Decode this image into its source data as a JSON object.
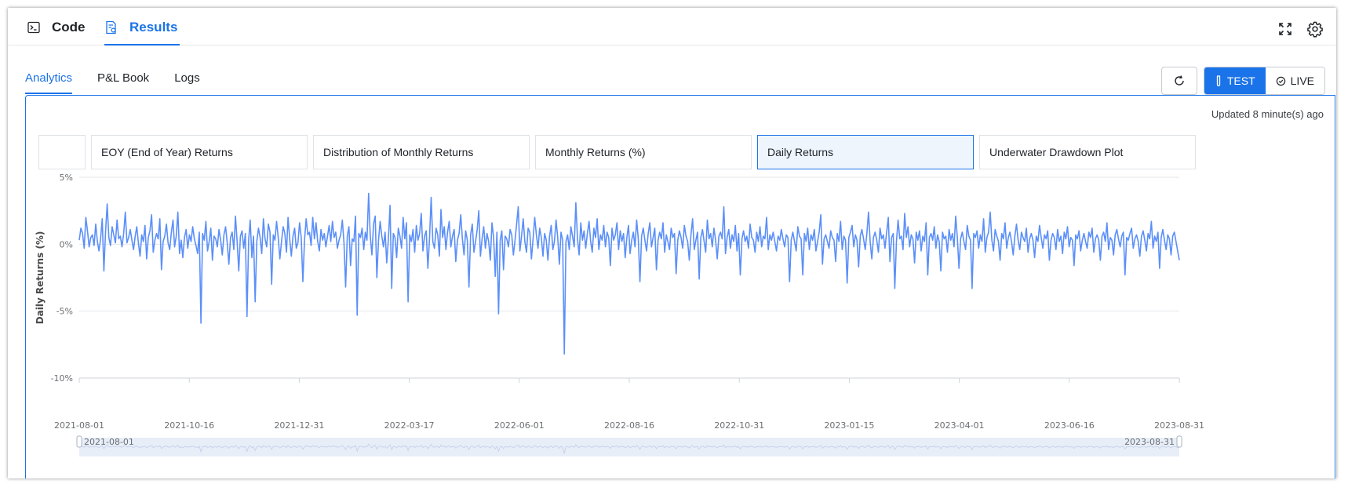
{
  "top_tabs": [
    {
      "label": "Code",
      "icon": "terminal-icon"
    },
    {
      "label": "Results",
      "icon": "report-icon",
      "active": true
    }
  ],
  "sub_tabs": [
    {
      "label": "Analytics",
      "active": true
    },
    {
      "label": "P&L Book"
    },
    {
      "label": "Logs"
    }
  ],
  "mode": {
    "test_label": "TEST",
    "live_label": "LIVE",
    "selected": "TEST"
  },
  "updated_text": "Updated 8 minute(s) ago",
  "chart_tabs": [
    {
      "label": ""
    },
    {
      "label": "EOY (End of Year) Returns"
    },
    {
      "label": "Distribution of Monthly Returns"
    },
    {
      "label": "Monthly Returns (%)"
    },
    {
      "label": "Daily Returns",
      "active": true
    },
    {
      "label": "Underwater Drawdown Plot"
    }
  ],
  "colors": {
    "accent": "#1a73e8",
    "series": "#5b8ff9",
    "active_tab_bg": "#eef5fc"
  },
  "chart_data": {
    "type": "line",
    "title": "",
    "ylabel": "Daily Returns (%)",
    "xlabel": "",
    "ylim": [
      -10,
      5
    ],
    "y_ticks": [
      "5%",
      "0%",
      "-5%",
      "-10%"
    ],
    "y_tick_values": [
      5,
      0,
      -5,
      -10
    ],
    "x_range": [
      "2021-08-01",
      "2023-08-31"
    ],
    "x_ticks": [
      "2021-08-01",
      "2021-10-16",
      "2021-12-31",
      "2022-03-17",
      "2022-06-01",
      "2022-08-16",
      "2022-10-31",
      "2023-01-15",
      "2023-04-01",
      "2023-06-16",
      "2023-08-31"
    ],
    "grid": true,
    "series": [
      {
        "values": [
          0.3,
          1.2,
          0.8,
          -0.3,
          2.0,
          1.0,
          -0.2,
          0.5,
          0.7,
          -0.1,
          1.5,
          0.2,
          -0.5,
          0.4,
          1.9,
          -2.0,
          0.9,
          3.0,
          0.5,
          -0.1,
          1.3,
          0.7,
          0.1,
          1.8,
          0.4,
          0.6,
          -0.2,
          0.8,
          2.4,
          0.1,
          0.5,
          1.1,
          0.3,
          -0.4,
          0.6,
          1.3,
          0.1,
          -0.9,
          0.7,
          0.2,
          1.4,
          -1.1,
          0.5,
          1.0,
          2.2,
          -0.6,
          0.3,
          0.8,
          0.4,
          1.9,
          -1.9,
          0.2,
          0.6,
          1.5,
          0.1,
          -0.4,
          0.9,
          1.8,
          -0.2,
          0.6,
          2.4,
          -0.7,
          0.3,
          -1.0,
          0.5,
          1.1,
          -0.3,
          0.7,
          0.2,
          1.3,
          0.4,
          -0.1,
          -0.7,
          0.9,
          -5.9,
          0.8,
          0.3,
          1.7,
          -0.5,
          0.2,
          1.2,
          -1.2,
          0.6,
          0.4,
          -0.2,
          1.1,
          0.3,
          -0.8,
          0.7,
          1.3,
          0.1,
          -1.5,
          0.5,
          0.9,
          -0.4,
          2.1,
          0.2,
          -2.0,
          0.6,
          1.0,
          -0.3,
          0.8,
          -5.4,
          0.3,
          1.8,
          -1.0,
          0.6,
          -4.3,
          0.2,
          1.2,
          0.5,
          -0.7,
          1.9,
          0.4,
          -0.2,
          1.5,
          0.9,
          -3.0,
          0.7,
          0.3,
          1.7,
          0.5,
          -1.1,
          0.2,
          1.3,
          0.8,
          -0.6,
          2.0,
          0.4,
          -0.9,
          0.6,
          1.2,
          -0.3,
          0.1,
          1.6,
          0.5,
          -2.8,
          0.3,
          1.9,
          0.7,
          0.9,
          -0.1,
          2.0,
          0.4,
          1.6,
          0.2,
          -0.5,
          1.1,
          0.3,
          0.8,
          -0.2,
          0.6,
          1.4,
          0.2,
          1.7,
          0.5,
          0.9,
          -0.3,
          0.3,
          0.7,
          1.8,
          0.1,
          -3.2,
          0.6,
          1.3,
          -1.6,
          0.4,
          0.2,
          2.1,
          -5.3,
          0.8,
          0.5,
          1.2,
          -0.4,
          0.9,
          0.3,
          3.8,
          0.6,
          -0.8,
          1.5,
          2.1,
          -2.5,
          0.3,
          1.7,
          0.6,
          -0.2,
          0.9,
          -1.4,
          0.4,
          2.9,
          -3.3,
          0.8,
          0.5,
          -1.0,
          1.2,
          0.6,
          -0.3,
          2.0,
          0.4,
          1.6,
          -4.3,
          0.7,
          0.2,
          1.1,
          -0.6,
          1.4,
          0.3,
          0.8,
          2.3,
          -0.5,
          0.6,
          1.0,
          -1.8,
          0.4,
          3.5,
          0.2,
          -0.3,
          1.2,
          0.7,
          -0.9,
          2.6,
          0.5,
          1.3,
          -0.4,
          0.9,
          1.7,
          -0.2,
          0.6,
          1.1,
          -1.3,
          0.3,
          0.8,
          2.2,
          0.4,
          -0.8,
          1.0,
          0.3,
          -3.2,
          0.7,
          1.5,
          -0.6,
          0.2,
          1.1,
          2.5,
          -0.9,
          0.4,
          1.3,
          -0.3,
          0.8,
          0.2,
          -1.2,
          1.6,
          0.5,
          -2.4,
          0.9,
          -5.2,
          0.3,
          1.0,
          -1.9,
          0.6,
          0.4,
          -0.2,
          1.1,
          0.7,
          -0.8,
          0.3,
          1.5,
          2.8,
          -0.5,
          0.6,
          1.9,
          0.2,
          -0.6,
          1.2,
          0.9,
          -1.1,
          0.4,
          2.0,
          0.7,
          -0.3,
          1.2,
          0.5,
          -0.9,
          0.8,
          0.3,
          -1.2,
          0.6,
          1.4,
          -0.4,
          0.2,
          1.8,
          0.5,
          -1.5,
          0.9,
          0.3,
          -8.2,
          0.2,
          0.7,
          -0.4,
          1.3,
          0.6,
          -0.2,
          3.1,
          0.4,
          -0.8,
          1.6,
          0.3,
          1.0,
          -0.3,
          0.8,
          1.7,
          0.2,
          -0.6,
          1.2,
          0.5,
          1.9,
          -0.4,
          0.7,
          0.3,
          1.4,
          -0.2,
          0.9,
          0.5,
          -1.6,
          1.2,
          0.3,
          0.7,
          1.6,
          -0.4,
          1.0,
          0.2,
          0.8,
          -1.0,
          0.5,
          1.4,
          -0.7,
          0.3,
          0.9,
          -0.2,
          1.8,
          0.4,
          -2.8,
          0.6,
          1.2,
          0.3,
          -0.5,
          0.8,
          1.6,
          -0.2,
          0.5,
          1.2,
          -1.9,
          0.3,
          0.9,
          0.4,
          1.6,
          -0.6,
          0.7,
          0.2,
          -0.4,
          1.2,
          0.5,
          0.8,
          -2.2,
          0.3,
          1.0,
          0.5,
          -0.3,
          1.4,
          0.6,
          0.2,
          -1.2,
          0.7,
          1.9,
          -0.4,
          0.3,
          0.9,
          -2.6,
          0.5,
          1.1,
          0.2,
          -0.6,
          1.8,
          0.4,
          0.8,
          -0.2,
          1.2,
          0.3,
          -1.1,
          0.6,
          0.9,
          0.4,
          2.8,
          -0.7,
          0.5,
          1.1,
          -0.3,
          0.7,
          0.2,
          1.4,
          -0.5,
          0.8,
          -2.3,
          0.4,
          1.0,
          0.2,
          0.6,
          -0.3,
          1.5,
          0.5,
          0.3,
          -0.6,
          0.9,
          0.2,
          1.3,
          -0.2,
          0.6,
          0.4,
          2.0,
          -0.4,
          0.7,
          0.3,
          0.9,
          0.2,
          -0.5,
          0.6,
          0.3,
          1.1,
          0.4,
          -0.2,
          0.7,
          0.5,
          -2.8,
          0.3,
          0.9,
          0.2,
          -0.5,
          1.3,
          0.6,
          0.4,
          -2.3,
          0.8,
          0.2,
          1.2,
          -0.4,
          0.7,
          0.3,
          1.1,
          -0.5,
          0.2,
          0.9,
          2.2,
          -1.5,
          0.4,
          0.7,
          0.2,
          -0.3,
          1.0,
          0.5,
          0.3,
          -1.3,
          0.8,
          0.2,
          1.7,
          -0.4,
          0.6,
          0.3,
          -2.9,
          0.5,
          0.9,
          1.4,
          -0.2,
          0.7,
          0.3,
          -1.7,
          0.6,
          1.1,
          0.4,
          -0.4,
          0.8,
          2.4,
          0.2,
          -1.1,
          0.5,
          0.9,
          0.3,
          -0.6,
          1.2,
          0.4,
          0.7,
          -0.3,
          0.9,
          2.0,
          -1.3,
          0.5,
          0.8,
          -3.3,
          0.2,
          1.8,
          0.4,
          0.6,
          -0.4,
          2.3,
          0.5,
          1.3,
          -0.2,
          0.7,
          0.4,
          -1.4,
          0.9,
          0.3,
          1.0,
          -0.5,
          0.6,
          0.2,
          1.6,
          -2.3,
          0.5,
          0.8,
          0.3,
          1.3,
          -0.3,
          0.7,
          0.2,
          -2.0,
          0.9,
          0.4,
          0.6,
          -0.6,
          1.1,
          0.3,
          0.8,
          -0.2,
          2.1,
          0.5,
          -1.8,
          0.4,
          0.9,
          0.2,
          -0.4,
          1.4,
          0.6,
          0.3,
          -3.3,
          0.8,
          0.5,
          1.0,
          -0.3,
          0.7,
          0.2,
          1.9,
          -0.6,
          0.5,
          0.9,
          2.4,
          0.3,
          -0.5,
          1.1,
          0.6,
          0.2,
          -1.2,
          0.8,
          0.4,
          1.6,
          -0.3,
          0.5,
          0.9,
          0.2,
          -0.8,
          0.6,
          1.5,
          0.3,
          -0.4,
          0.9,
          0.5,
          0.2,
          1.2,
          -0.6,
          0.4,
          0.8,
          0.3,
          -1.0,
          0.6,
          0.2,
          1.4,
          0.5,
          -0.3,
          0.7,
          0.4,
          1.0,
          -1.2,
          0.3,
          0.8,
          0.5,
          -0.4,
          1.1,
          0.2,
          0.6,
          -0.7,
          0.9,
          0.4,
          1.3,
          -0.2,
          0.5,
          0.3,
          -1.6,
          0.7,
          0.4,
          1.0,
          -0.5,
          0.3,
          0.8,
          0.2,
          -0.3,
          0.9,
          0.5,
          1.2,
          -0.6,
          0.4,
          0.7,
          0.3,
          -1.2,
          0.6,
          0.9,
          0.2,
          1.6,
          -0.4,
          0.5,
          0.3,
          -0.8,
          0.7,
          1.1,
          0.4,
          -0.2,
          0.6,
          0.9,
          -2.3,
          0.5,
          0.3,
          0.8,
          1.2,
          -0.3,
          0.4,
          0.7,
          0.2,
          -0.9,
          0.6,
          1.0,
          0.3,
          -0.5,
          0.8,
          0.4,
          1.7,
          -0.3,
          0.6,
          0.2,
          0.9,
          -1.8,
          0.5,
          1.1,
          0.3,
          -0.4,
          0.7,
          0.4,
          -0.8,
          0.6,
          0.9,
          0.2,
          -0.5,
          -1.2
        ]
      }
    ],
    "slider": {
      "start_label": "2021-08-01",
      "end_label": "2023-08-31"
    }
  }
}
